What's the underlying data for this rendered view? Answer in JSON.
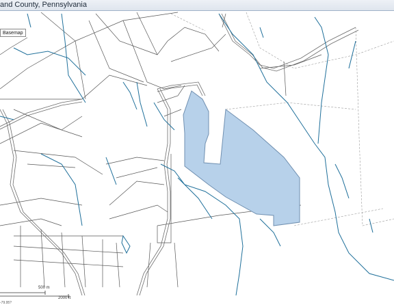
{
  "title": {
    "text": "and County, Pennsylvania"
  },
  "controls": {
    "basemap_label": "Basemap"
  },
  "scale": {
    "metric_label": "500 m",
    "imperial_label": "2000 ft"
  },
  "coordinates": {
    "text": "-79.95? "
  },
  "colors": {
    "parcel_fill": "#b7d1ea",
    "parcel_stroke": "#6f8fb0",
    "water": "#1e6f9a",
    "boundary": "#555555",
    "road": "#6b6b6b",
    "title_bar": "#e6ebf2"
  },
  "map": {
    "highlighted_feature": "subject-parcel"
  }
}
